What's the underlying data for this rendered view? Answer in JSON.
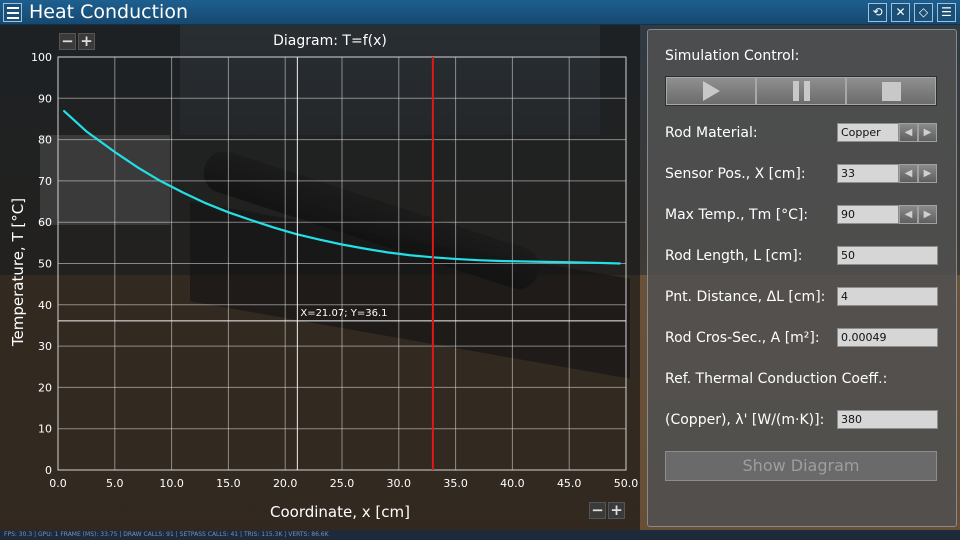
{
  "app": {
    "title": "Heat Conduction"
  },
  "toolbar_icons": [
    "reset-icon",
    "mute-icon",
    "eraser-icon",
    "settings-list-icon"
  ],
  "chart": {
    "title": "Diagram: T=f(x)",
    "cursor_readout": "X=21.07; Y=36.1",
    "zoom_minus": "−",
    "zoom_plus": "+"
  },
  "chart_data": {
    "type": "line",
    "title": "Diagram: T=f(x)",
    "xlabel": "Coordinate, x [cm]",
    "ylabel": "Temperature, T [°C]",
    "xlim": [
      0,
      50
    ],
    "ylim": [
      0,
      100
    ],
    "x_ticks": [
      "0.0",
      "5.0",
      "10.0",
      "15.0",
      "20.0",
      "25.0",
      "30.0",
      "35.0",
      "40.0",
      "45.0",
      "50.0"
    ],
    "y_ticks": [
      "0",
      "10",
      "20",
      "30",
      "40",
      "50",
      "60",
      "70",
      "80",
      "90",
      "100"
    ],
    "grid": true,
    "series": [
      {
        "color": "#22e0e6",
        "x": [
          0.5,
          2.5,
          5,
          7,
          9,
          11,
          13,
          15,
          17,
          19,
          21,
          23,
          25,
          27,
          29,
          31,
          33,
          35,
          37,
          39,
          41,
          43,
          45,
          47,
          49.5
        ],
        "y": [
          87,
          82,
          77,
          73.3,
          70,
          67.2,
          64.6,
          62.4,
          60.5,
          58.7,
          57.1,
          55.8,
          54.6,
          53.6,
          52.7,
          52,
          51.5,
          51.1,
          50.8,
          50.6,
          50.5,
          50.4,
          50.3,
          50.2,
          50
        ]
      }
    ],
    "sensor_marker_x": 33,
    "sensor_marker_color": "#e01818",
    "cursor_x": 21.07,
    "cursor_y": 36.1
  },
  "control": {
    "simulation_label": "Simulation Control:",
    "rod_material_label": "Rod Material:",
    "rod_material_value": "Copper",
    "sensor_pos_label": "Sensor Pos., X [cm]:",
    "sensor_pos_value": "33",
    "max_temp_label": "Max Temp., Tm [°C]:",
    "max_temp_value": "90",
    "rod_length_label": "Rod Length, L [cm]:",
    "rod_length_value": "50",
    "pnt_distance_label": "Pnt. Distance, ΔL [cm]:",
    "pnt_distance_value": "4",
    "cross_section_label": "Rod Cros-Sec., A [m²]:",
    "cross_section_value": "0.00049",
    "ref_coeff_label": "Ref. Thermal Conduction Coeff.:",
    "copper_coeff_label": "(Copper), λ' [W/(m·K)]:",
    "copper_coeff_value": "380",
    "show_diagram_label": "Show Diagram"
  },
  "spin_arrows": {
    "left": "◀",
    "right": "▶"
  },
  "status_text": "FPS: 30.3 | GPU: 1 FRAME (MS): 33.75 | DRAW CALLS: 91 | SETPASS CALLS: 41 | TRIS: 115.3K | VERTS: 86.6K"
}
